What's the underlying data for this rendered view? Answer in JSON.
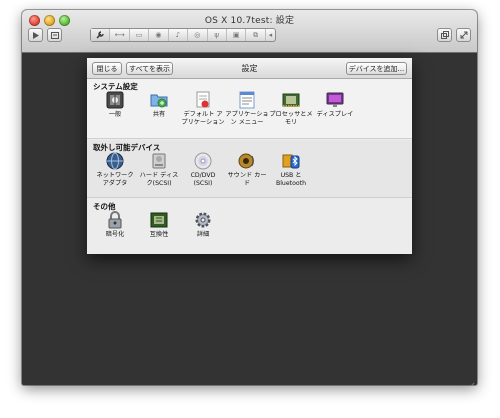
{
  "window": {
    "title": "OS X 10.7test: 設定"
  },
  "dialog": {
    "close_label": "閉じる",
    "show_all_label": "すべてを表示",
    "title": "設定",
    "add_device_label": "デバイスを追加..."
  },
  "sections": [
    {
      "title": "システム設定",
      "items": [
        {
          "label": "一般",
          "icon": "gear-switch-icon"
        },
        {
          "label": "共有",
          "icon": "shared-folder-icon"
        },
        {
          "label": "デフォルト アプリケーション",
          "icon": "default-apps-icon"
        },
        {
          "label": "アプリケーション メニュー",
          "icon": "application-menu-icon"
        },
        {
          "label": "プロセッサとメモリ",
          "icon": "cpu-chip-icon"
        },
        {
          "label": "ディスプレイ",
          "icon": "display-icon"
        }
      ]
    },
    {
      "title": "取外し可能デバイス",
      "items": [
        {
          "label": "ネットワーク アダプタ",
          "icon": "network-globe-icon"
        },
        {
          "label": "ハード ディスク(SCSI)",
          "icon": "hard-disk-icon"
        },
        {
          "label": "CD/DVD (SCSI)",
          "icon": "cd-dvd-icon"
        },
        {
          "label": "サウンド カード",
          "icon": "speaker-icon"
        },
        {
          "label": "USB と Bluetooth",
          "icon": "usb-bluetooth-icon"
        }
      ]
    },
    {
      "title": "その他",
      "items": [
        {
          "label": "暗号化",
          "icon": "lock-icon"
        },
        {
          "label": "互換性",
          "icon": "compatibility-chip-icon"
        },
        {
          "label": "詳細",
          "icon": "advanced-gear-icon"
        }
      ]
    }
  ]
}
